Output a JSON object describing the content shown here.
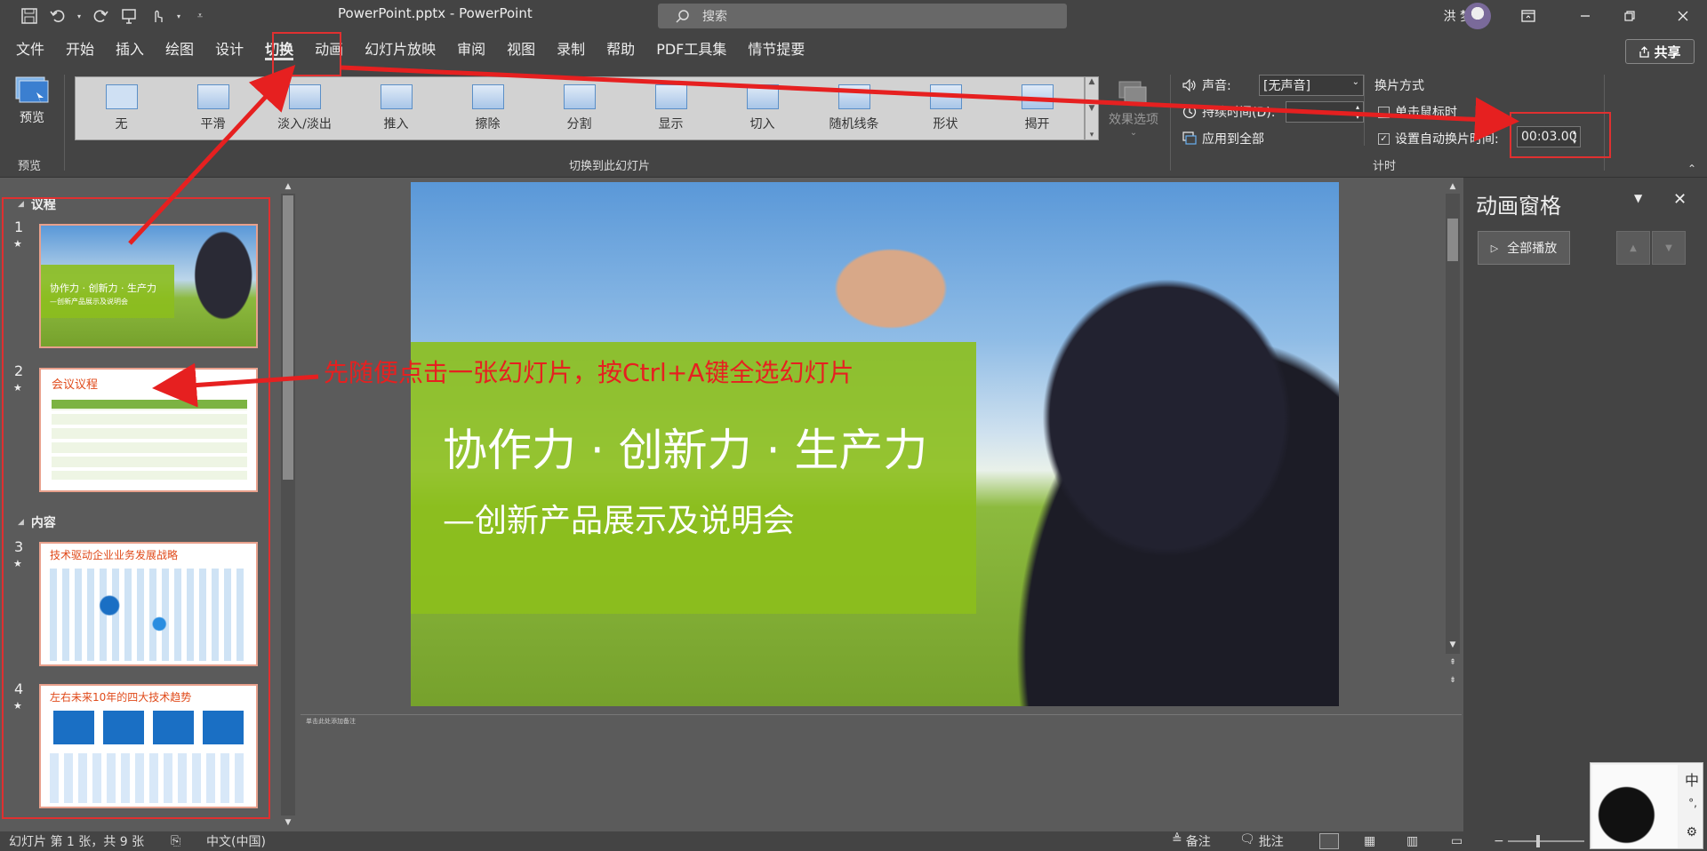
{
  "app": {
    "doc_title": "PowerPoint.pptx  -  PowerPoint",
    "search_placeholder": "搜索",
    "user_name": "洪 梦苑",
    "share_label": "共享"
  },
  "menu": [
    {
      "label": "文件"
    },
    {
      "label": "开始"
    },
    {
      "label": "插入"
    },
    {
      "label": "绘图"
    },
    {
      "label": "设计"
    },
    {
      "label": "切换",
      "active": true
    },
    {
      "label": "动画"
    },
    {
      "label": "幻灯片放映"
    },
    {
      "label": "审阅"
    },
    {
      "label": "视图"
    },
    {
      "label": "录制"
    },
    {
      "label": "帮助"
    },
    {
      "label": "PDF工具集"
    },
    {
      "label": "情节提要"
    }
  ],
  "ribbon": {
    "preview_label": "预览",
    "preview_group": "预览",
    "transitions": [
      "无",
      "平滑",
      "淡入/淡出",
      "推入",
      "擦除",
      "分割",
      "显示",
      "切入",
      "随机线条",
      "形状",
      "揭开"
    ],
    "effect_options": "效果选项",
    "transition_group": "切换到此幻灯片",
    "sound_label": "声音:",
    "sound_value": "[无声音]",
    "duration_label": "持续时间(D):",
    "apply_all": "应用到全部",
    "advance_title": "换片方式",
    "on_click": "单击鼠标时",
    "auto_after": "设置自动换片时间:",
    "auto_time": "00:03.00",
    "timing_group": "计时"
  },
  "slides_pane": {
    "sections": [
      {
        "name": "议程"
      },
      {
        "name": "内容"
      }
    ],
    "slides": [
      {
        "num": "1",
        "title": "协作力 · 创新力 · 生产力",
        "subtitle": "—创新产品展示及说明会"
      },
      {
        "num": "2",
        "title": "会议议程"
      },
      {
        "num": "3",
        "title": "技术驱动企业业务发展战略"
      },
      {
        "num": "4",
        "title": "左右未来10年的四大技术趋势"
      }
    ]
  },
  "main_slide": {
    "title": "协作力 · 创新力 · 生产力",
    "subtitle": "—创新产品展示及说明会"
  },
  "notes_placeholder": "单击此处添加备注",
  "annotation": "先随便点击一张幻灯片，按Ctrl+A键全选幻灯片",
  "anim_pane": {
    "title": "动画窗格",
    "play_all": "全部播放"
  },
  "status": {
    "slide_info": "幻灯片 第 1 张，共 9 张",
    "language": "中文(中国)",
    "notes": "备注",
    "comments": "批注"
  },
  "ime": {
    "mode": "中",
    "punct": "°,"
  },
  "colors": {
    "accent_red": "#e03030",
    "slide_green": "#8cbf1c"
  }
}
